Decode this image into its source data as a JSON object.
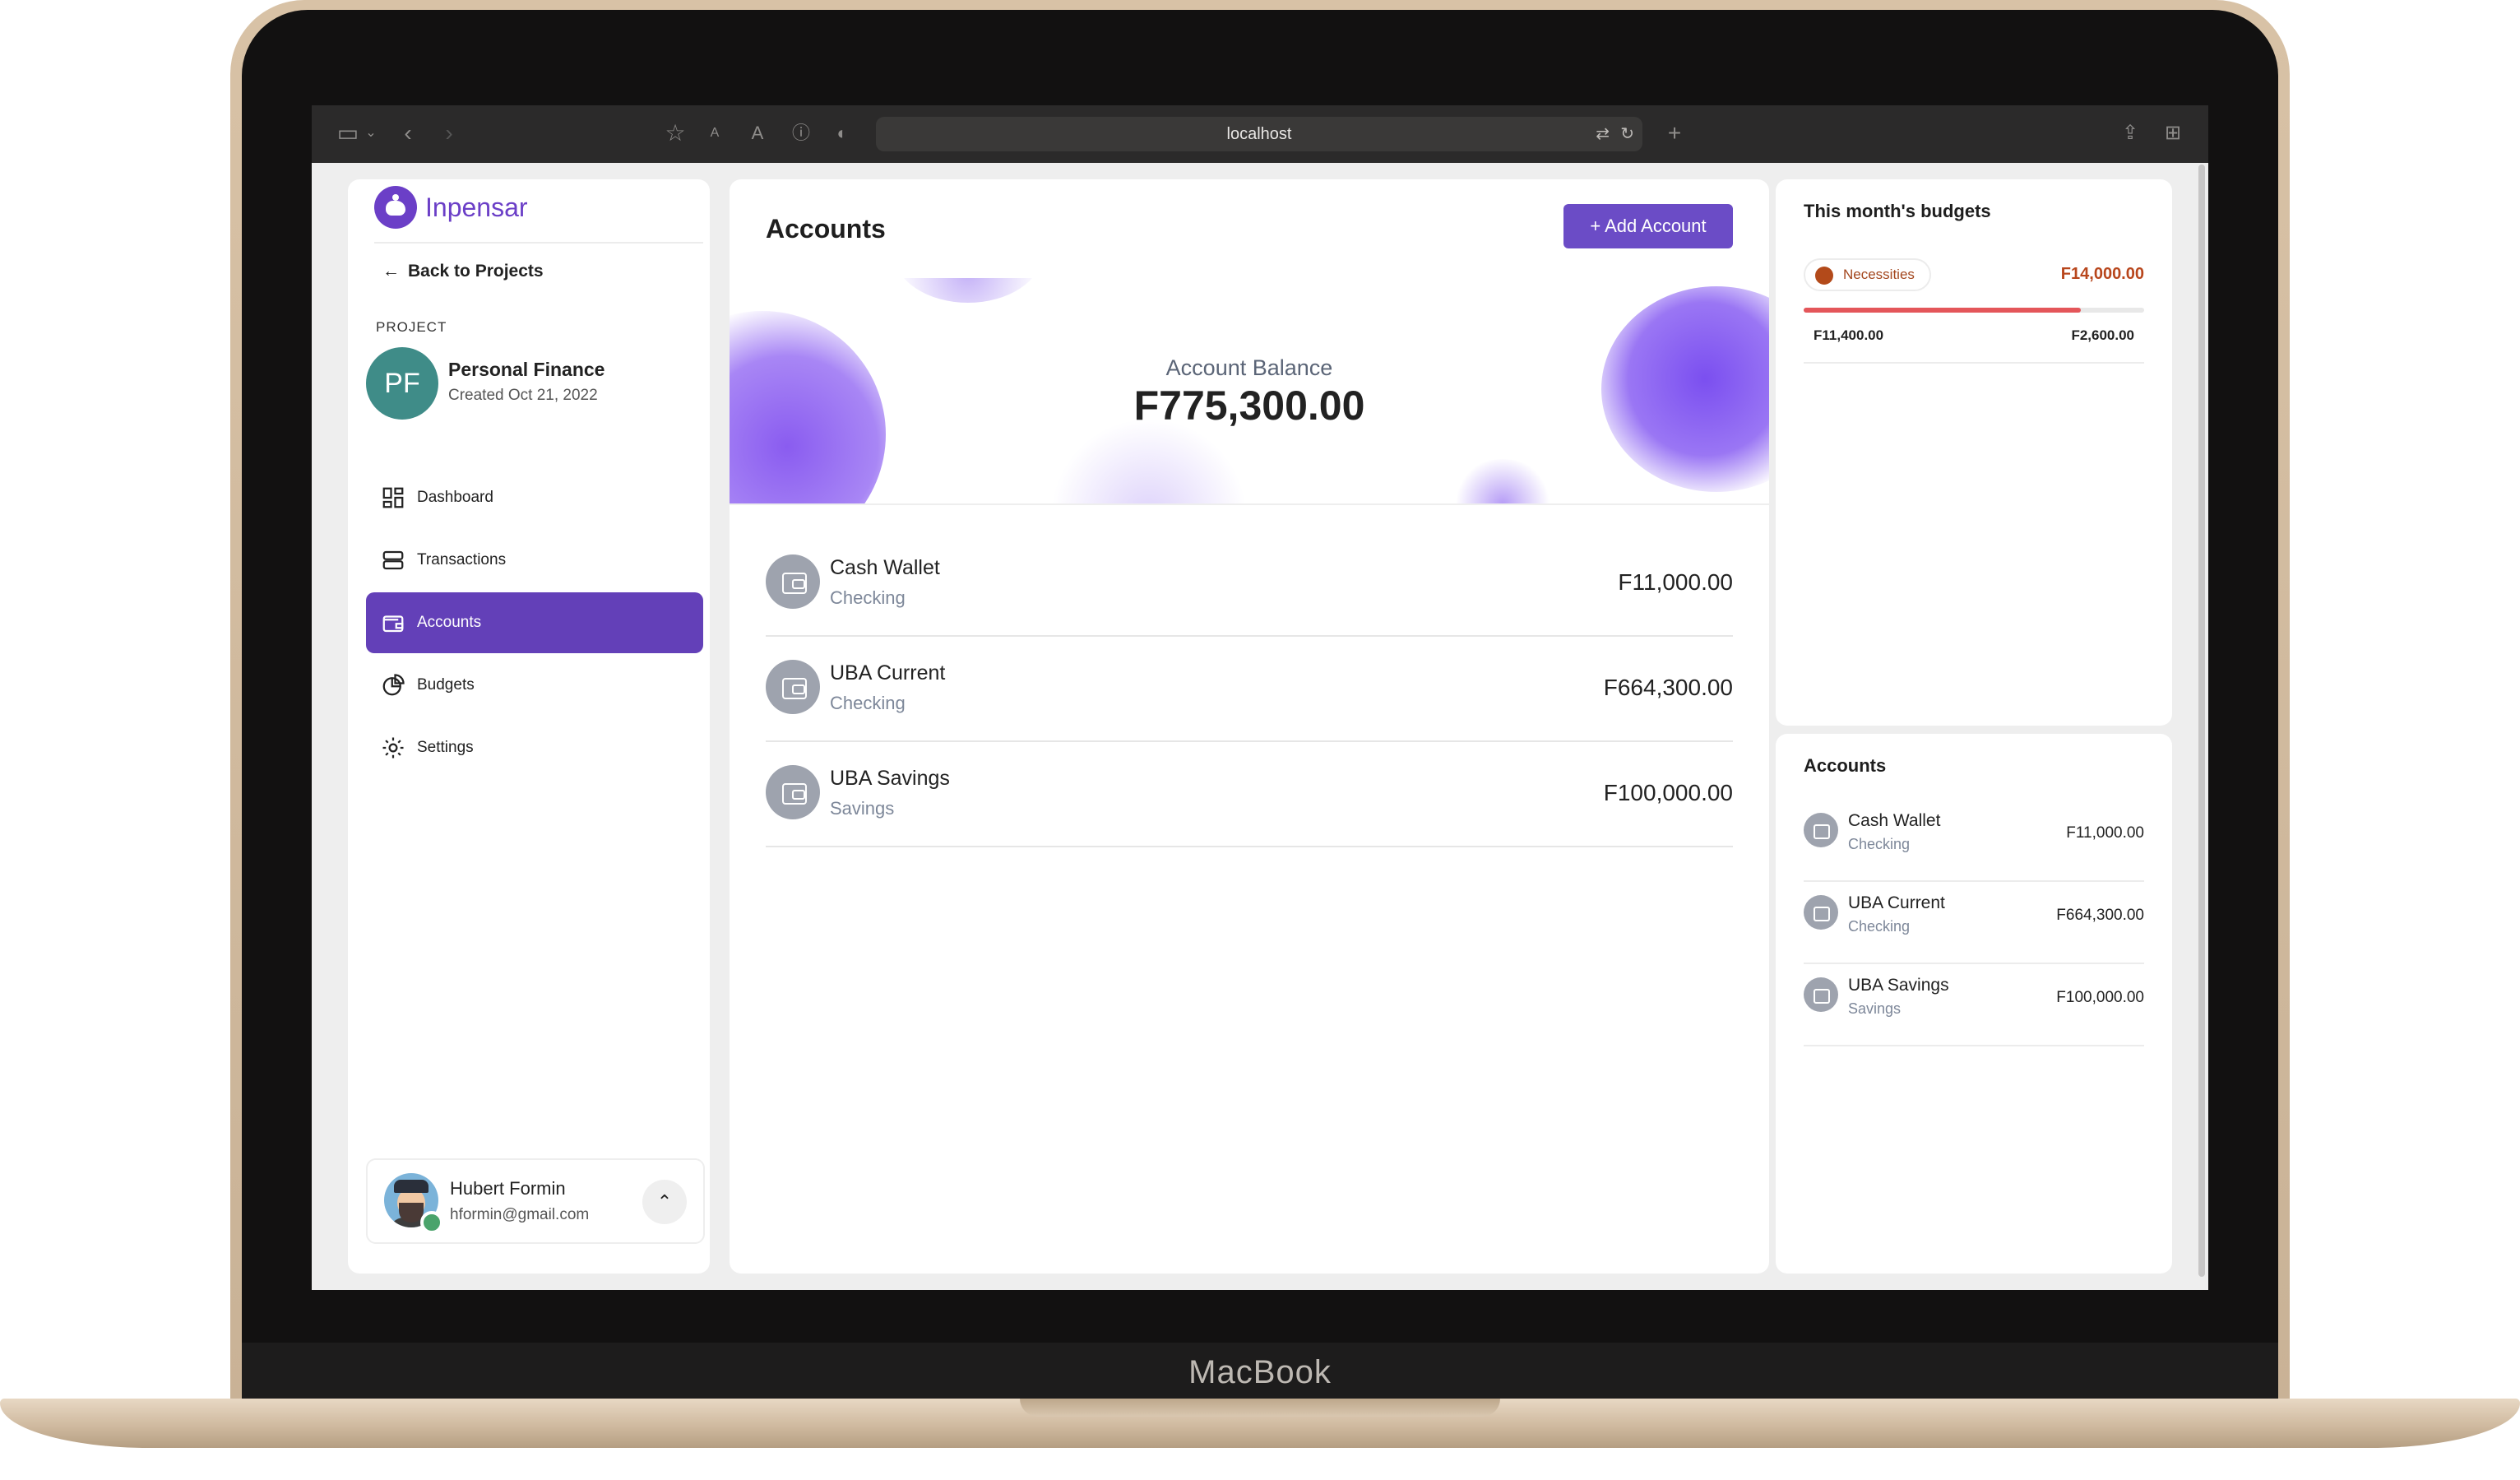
{
  "device_label": "MacBook",
  "browser": {
    "url": "localhost"
  },
  "sidebar": {
    "brand": "Inpensar",
    "back_link": "Back to Projects",
    "project_label": "PROJECT",
    "project_initials": "PF",
    "project_name": "Personal Finance",
    "project_created": "Created Oct 21, 2022",
    "nav": [
      {
        "label": "Dashboard",
        "icon": "dashboard-icon",
        "active": false
      },
      {
        "label": "Transactions",
        "icon": "transactions-icon",
        "active": false
      },
      {
        "label": "Accounts",
        "icon": "wallet-icon",
        "active": true
      },
      {
        "label": "Budgets",
        "icon": "pie-chart-icon",
        "active": false
      },
      {
        "label": "Settings",
        "icon": "gear-icon",
        "active": false
      }
    ],
    "user": {
      "name": "Hubert Formin",
      "email": "hformin@gmail.com",
      "online": true
    }
  },
  "main": {
    "title": "Accounts",
    "add_button": "+ Add Account",
    "balance_label": "Account Balance",
    "balance_value": "F775,300.00",
    "accounts": [
      {
        "name": "Cash Wallet",
        "type": "Checking",
        "amount": "F11,000.00"
      },
      {
        "name": "UBA Current",
        "type": "Checking",
        "amount": "F664,300.00"
      },
      {
        "name": "UBA Savings",
        "type": "Savings",
        "amount": "F100,000.00"
      }
    ]
  },
  "budgets": {
    "title": "This month's budgets",
    "items": [
      {
        "name": "Necessities",
        "total": "F14,000.00",
        "spent": "F11,400.00",
        "remaining": "F2,600.00",
        "progress_percent": 81.4,
        "color": "#b34a1a"
      }
    ]
  },
  "accounts_panel": {
    "title": "Accounts",
    "accounts": [
      {
        "name": "Cash Wallet",
        "type": "Checking",
        "amount": "F11,000.00"
      },
      {
        "name": "UBA Current",
        "type": "Checking",
        "amount": "F664,300.00"
      },
      {
        "name": "UBA Savings",
        "type": "Savings",
        "amount": "F100,000.00"
      }
    ]
  },
  "colors": {
    "accent": "#6340b8",
    "brand": "#6b3fc7",
    "budget_warning": "#e4565a",
    "project_avatar": "#3f8c88"
  }
}
